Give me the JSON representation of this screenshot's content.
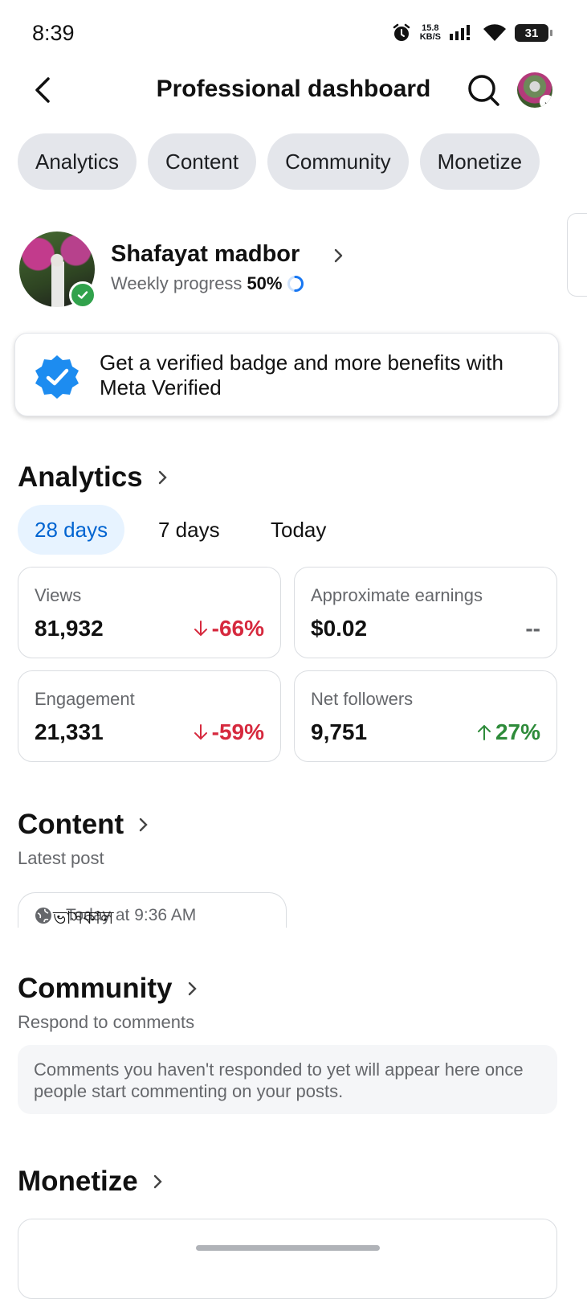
{
  "status_bar": {
    "time": "8:39",
    "net_speed_value": "15.8",
    "net_speed_unit": "KB/S",
    "battery": "31"
  },
  "header": {
    "title": "Professional dashboard"
  },
  "tabs": [
    "Analytics",
    "Content",
    "Community",
    "Monetize"
  ],
  "profile": {
    "name": "Shafayat madbor",
    "progress_label": "Weekly progress",
    "progress_value": "50%",
    "progress_fraction": 0.5
  },
  "meta_verified": {
    "text": "Get a verified badge and more benefits with Meta Verified"
  },
  "analytics": {
    "title": "Analytics",
    "date_tabs": [
      "28 days",
      "7 days",
      "Today"
    ],
    "selected_date_tab": "28 days",
    "metrics": [
      {
        "label": "Views",
        "value": "81,932",
        "change": "-66%",
        "trend": "down"
      },
      {
        "label": "Approximate earnings",
        "value": "$0.02",
        "change": "--",
        "trend": "none"
      },
      {
        "label": "Engagement",
        "value": "21,331",
        "change": "-59%",
        "trend": "down"
      },
      {
        "label": "Net followers",
        "value": "9,751",
        "change": "27%",
        "trend": "up"
      }
    ]
  },
  "content": {
    "title": "Content",
    "subtitle": "Latest post",
    "post_title": "ভাসকাল",
    "post_meta": "Today at 9:36 AM"
  },
  "community": {
    "title": "Community",
    "subtitle": "Respond to comments",
    "empty_text": "Comments you haven't responded to yet will appear here once people start commenting on your posts."
  },
  "monetize": {
    "title": "Monetize"
  },
  "colors": {
    "accent_blue": "#0064d1",
    "negative_red": "#d6293e",
    "positive_green": "#2e8b3a",
    "tab_bg": "#e4e6eb"
  }
}
